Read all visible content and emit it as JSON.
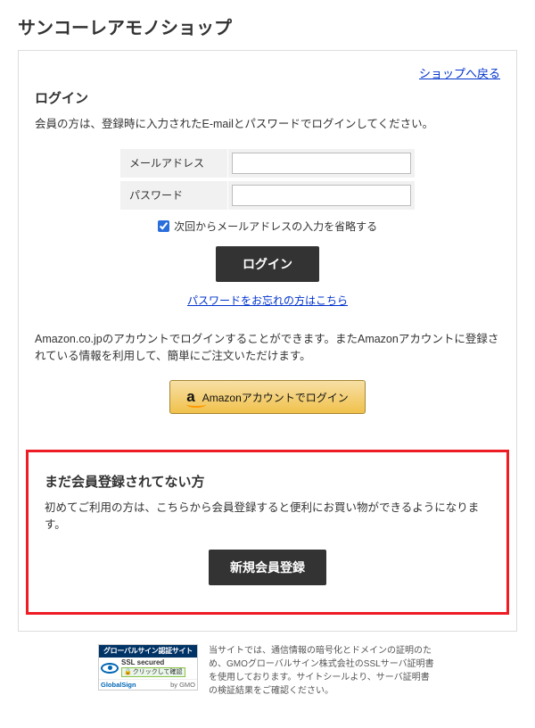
{
  "page_title": "サンコーレアモノショップ",
  "back_link": "ショップへ戻る",
  "login": {
    "heading": "ログイン",
    "desc": "会員の方は、登録時に入力されたE-mailとパスワードでログインしてください。",
    "email_label": "メールアドレス",
    "password_label": "パスワード",
    "remember_label": "次回からメールアドレスの入力を省略する",
    "button": "ログイン",
    "forgot_link": "パスワードをお忘れの方はこちら"
  },
  "amazon": {
    "desc": "Amazon.co.jpのアカウントでログインすることができます。またAmazonアカウントに登録されている情報を利用して、簡単にご注文いただけます。",
    "button": "Amazonアカウントでログイン",
    "logo": "a"
  },
  "register": {
    "heading": "まだ会員登録されてない方",
    "desc": "初めてご利用の方は、こちらから会員登録すると便利にお買い物ができるようになります。",
    "button": "新規会員登録"
  },
  "footer": {
    "seal_top": "グローバルサイン認証サイト",
    "seal_ssl": "SSL secured",
    "seal_click": "クリックして確認",
    "seal_brand": "GlobalSign",
    "seal_gmo": "by GMO",
    "text": "当サイトでは、通信情報の暗号化とドメインの証明のため、GMOグローバルサイン株式会社のSSLサーバ証明書を使用しております。サイトシールより、サーバ証明書の検証結果をご確認ください。"
  }
}
